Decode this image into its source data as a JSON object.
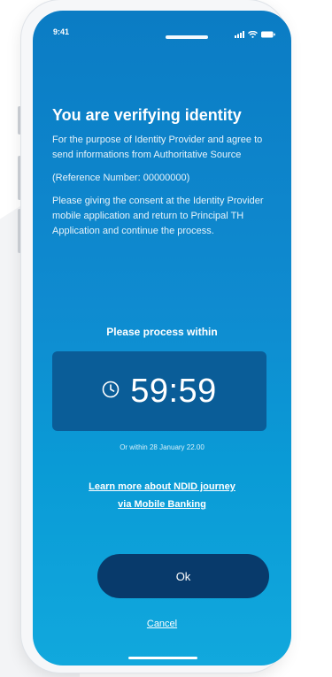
{
  "status_bar": {
    "time": "9:41",
    "icons": [
      "signal-icon",
      "wifi-icon",
      "battery-icon"
    ]
  },
  "main": {
    "title": "You are verifying identity",
    "paragraph_1": "For the purpose of Identity Provider and agree to send informations from Authoritative Source",
    "reference": "(Reference Number: 00000000)",
    "paragraph_2": "Please giving the consent at the Identity Provider mobile application and return to Principal TH Application and continue the process.",
    "process_label": "Please process within",
    "timer": "59:59",
    "timer_icon": "clock-icon",
    "within_text": "Or within 28 January 22.00",
    "learn_more_line_1": "Learn more about NDID journey",
    "learn_more_line_2": "via Mobile Banking"
  },
  "actions": {
    "ok_label": "Ok",
    "cancel_label": "Cancel"
  },
  "colors": {
    "screen_top": "#0b7cc4",
    "screen_bottom": "#11a8dd",
    "timer_card": "#0a5d98",
    "ok_button": "#083a6b"
  }
}
